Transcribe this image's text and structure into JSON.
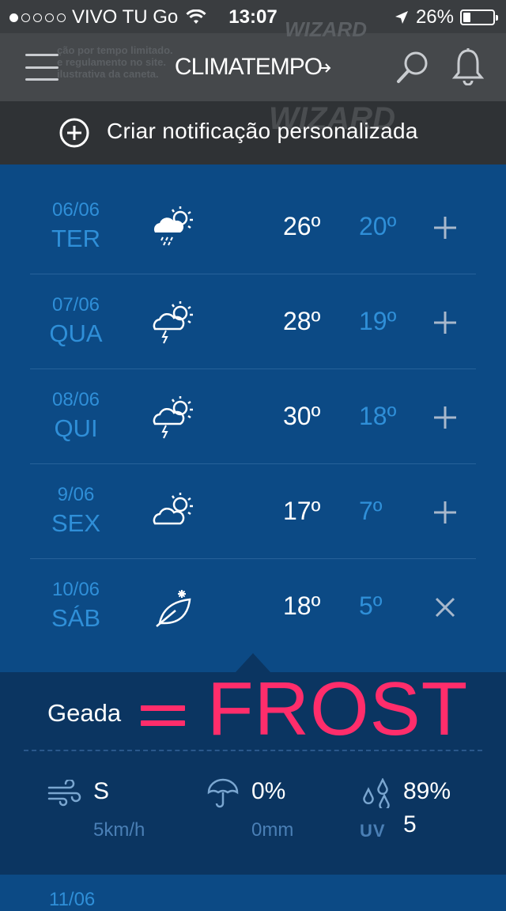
{
  "status_bar": {
    "carrier": "VIVO TU Go",
    "time": "13:07",
    "battery": "26%",
    "battery_level": 0.26,
    "signal_bars": 1
  },
  "header": {
    "logo": "CLIMATEMPO",
    "ad_text": [
      "ção por tempo limitado.",
      "e regulamento no site.",
      "ilustrativa da caneta."
    ],
    "ad_brand": "WIZARD"
  },
  "notification": {
    "label": "Criar notificação personalizada",
    "ad_brand": "WIZARD"
  },
  "forecast": [
    {
      "date": "06/06",
      "dow": "TER",
      "icon": "partly-cloudy-rain-icon",
      "max": "26º",
      "min": "20º",
      "action": "plus"
    },
    {
      "date": "07/06",
      "dow": "QUA",
      "icon": "partly-cloudy-thunder-icon",
      "max": "28º",
      "min": "19º",
      "action": "plus"
    },
    {
      "date": "08/06",
      "dow": "QUI",
      "icon": "partly-cloudy-thunder-icon",
      "max": "30º",
      "min": "18º",
      "action": "plus"
    },
    {
      "date": "9/06",
      "dow": "SEX",
      "icon": "partly-cloudy-icon",
      "max": "17º",
      "min": "7º",
      "action": "plus"
    },
    {
      "date": "10/06",
      "dow": "SÁB",
      "icon": "frost-leaf-icon",
      "max": "18º",
      "min": "5º",
      "action": "close"
    }
  ],
  "detail": {
    "condition": "Geada",
    "annotation": "FROST",
    "wind_dir": "S",
    "wind_speed": "5km/h",
    "rain_prob": "0%",
    "rain_mm": "0mm",
    "humidity": "89%",
    "uv_label": "UV",
    "uv_value": "5"
  },
  "next_row": {
    "date": "11/06"
  },
  "colors": {
    "background": "#0c4a85",
    "accent_blue": "#2f8fd8",
    "annotation_pink": "#ff2d6b",
    "detail_panel": "#0b3561"
  }
}
